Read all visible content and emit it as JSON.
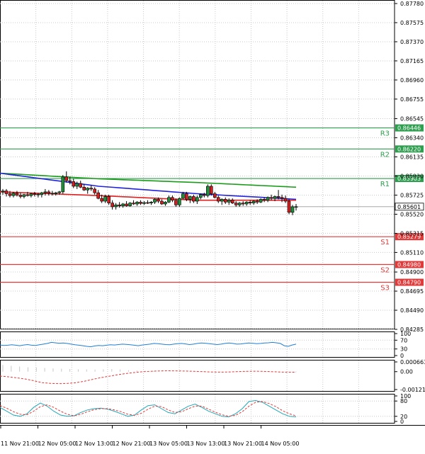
{
  "chart_data": {
    "type": "candlestick",
    "timeframe_labels": [
      "11 Nov 21:00",
      "12 Nov 05:00",
      "12 Nov 13:00",
      "12 Nov 21:00",
      "13 Nov 05:00",
      "13 Nov 13:00",
      "13 Nov 21:00",
      "14 Nov 05:00"
    ],
    "y_ticks": [
      "0.87780",
      "0.87575",
      "0.87370",
      "0.87165",
      "0.86960",
      "0.86755",
      "0.86545",
      "0.86340",
      "0.86135",
      "0.85930",
      "0.85725",
      "0.85520",
      "0.85315",
      "0.85110",
      "0.84900",
      "0.84695",
      "0.84490",
      "0.84285"
    ],
    "ylim": [
      0.84285,
      0.8778
    ],
    "last_price": {
      "label": "0.85601",
      "value": 0.85601
    },
    "levels": [
      {
        "name": "R3",
        "label": "0.86446",
        "value": 0.86446,
        "color": "#2e9e4f"
      },
      {
        "name": "R2",
        "label": "0.86220",
        "value": 0.8622,
        "color": "#2e9e4f"
      },
      {
        "name": "R1",
        "label": "0.85903",
        "value": 0.85903,
        "color": "#2e9e4f"
      },
      {
        "name": "S1",
        "label": "0.85279",
        "value": 0.85279,
        "color": "#e03b3b"
      },
      {
        "name": "S2",
        "label": "0.84980",
        "value": 0.8498,
        "color": "#e03b3b"
      },
      {
        "name": "S3",
        "label": "0.84790",
        "value": 0.8479,
        "color": "#e03b3b"
      }
    ],
    "ohlc": [
      [
        0.8576,
        0.8579,
        0.8573,
        0.8577
      ],
      [
        0.8577,
        0.8579,
        0.8571,
        0.8574
      ],
      [
        0.8574,
        0.8577,
        0.857,
        0.8572
      ],
      [
        0.8572,
        0.8576,
        0.857,
        0.85745
      ],
      [
        0.85745,
        0.8577,
        0.8571,
        0.85725
      ],
      [
        0.85725,
        0.8575,
        0.8569,
        0.8571
      ],
      [
        0.8571,
        0.8574,
        0.8569,
        0.8573
      ],
      [
        0.8573,
        0.8576,
        0.8571,
        0.8572
      ],
      [
        0.8572,
        0.8575,
        0.857,
        0.8574
      ],
      [
        0.8574,
        0.8576,
        0.8571,
        0.8573
      ],
      [
        0.8573,
        0.8575,
        0.857,
        0.85735
      ],
      [
        0.8573,
        0.8576,
        0.857,
        0.8575
      ],
      [
        0.8575,
        0.8579,
        0.8572,
        0.8576
      ],
      [
        0.8576,
        0.8578,
        0.8572,
        0.85745
      ],
      [
        0.85745,
        0.8577,
        0.8572,
        0.8574
      ],
      [
        0.8574,
        0.8576,
        0.8572,
        0.8575
      ],
      [
        0.8575,
        0.8577,
        0.8573,
        0.8576
      ],
      [
        0.8576,
        0.8594,
        0.8574,
        0.8592
      ],
      [
        0.8592,
        0.8598,
        0.8586,
        0.8588
      ],
      [
        0.8588,
        0.8592,
        0.8584,
        0.8587
      ],
      [
        0.8587,
        0.859,
        0.858,
        0.8582
      ],
      [
        0.8582,
        0.8587,
        0.8579,
        0.8585
      ],
      [
        0.8585,
        0.8588,
        0.858,
        0.8581
      ],
      [
        0.8581,
        0.8584,
        0.8577,
        0.8578
      ],
      [
        0.8578,
        0.8581,
        0.8574,
        0.858
      ],
      [
        0.858,
        0.8583,
        0.8577,
        0.8579
      ],
      [
        0.8579,
        0.8581,
        0.8573,
        0.8575
      ],
      [
        0.8575,
        0.8578,
        0.8568,
        0.8569
      ],
      [
        0.8569,
        0.8573,
        0.8564,
        0.8566
      ],
      [
        0.8566,
        0.8573,
        0.8564,
        0.8571
      ],
      [
        0.8571,
        0.8573,
        0.8562,
        0.8564
      ],
      [
        0.8564,
        0.8567,
        0.8557,
        0.856
      ],
      [
        0.856,
        0.8564,
        0.8557,
        0.8562
      ],
      [
        0.8562,
        0.8565,
        0.8559,
        0.8561
      ],
      [
        0.8561,
        0.8564,
        0.8559,
        0.8563
      ],
      [
        0.8563,
        0.8566,
        0.856,
        0.8561
      ],
      [
        0.8561,
        0.8565,
        0.856,
        0.8564
      ],
      [
        0.8564,
        0.8567,
        0.8562,
        0.8563
      ],
      [
        0.8563,
        0.8566,
        0.8561,
        0.8565
      ],
      [
        0.8565,
        0.8567,
        0.8562,
        0.85635
      ],
      [
        0.85635,
        0.8566,
        0.8562,
        0.85645
      ],
      [
        0.85645,
        0.8567,
        0.8563,
        0.8564
      ],
      [
        0.8564,
        0.8566,
        0.8562,
        0.8565
      ],
      [
        0.8565,
        0.8569,
        0.8563,
        0.8568
      ],
      [
        0.8568,
        0.857,
        0.8564,
        0.8566
      ],
      [
        0.8566,
        0.8568,
        0.8562,
        0.8563
      ],
      [
        0.8563,
        0.8566,
        0.8561,
        0.8565
      ],
      [
        0.8565,
        0.8572,
        0.8564,
        0.857
      ],
      [
        0.857,
        0.8572,
        0.8565,
        0.8567
      ],
      [
        0.8567,
        0.8569,
        0.856,
        0.8562
      ],
      [
        0.8562,
        0.857,
        0.856,
        0.8569
      ],
      [
        0.8569,
        0.8576,
        0.8568,
        0.8574
      ],
      [
        0.8574,
        0.8576,
        0.8566,
        0.8568
      ],
      [
        0.8568,
        0.8572,
        0.8564,
        0.8571
      ],
      [
        0.8571,
        0.8573,
        0.8564,
        0.8566
      ],
      [
        0.8566,
        0.8572,
        0.8563,
        0.857
      ],
      [
        0.857,
        0.8574,
        0.8568,
        0.8573
      ],
      [
        0.8573,
        0.8575,
        0.857,
        0.8572
      ],
      [
        0.8572,
        0.8584,
        0.857,
        0.8582
      ],
      [
        0.8582,
        0.8584,
        0.8572,
        0.8574
      ],
      [
        0.8574,
        0.8576,
        0.8569,
        0.857
      ],
      [
        0.857,
        0.8572,
        0.8564,
        0.8566
      ],
      [
        0.8566,
        0.8569,
        0.8562,
        0.8568
      ],
      [
        0.8568,
        0.857,
        0.8563,
        0.8565
      ],
      [
        0.8565,
        0.8569,
        0.8562,
        0.8567
      ],
      [
        0.8567,
        0.8569,
        0.8563,
        0.8564
      ],
      [
        0.8564,
        0.8566,
        0.856,
        0.8562
      ],
      [
        0.8562,
        0.8565,
        0.856,
        0.8564
      ],
      [
        0.8564,
        0.8566,
        0.8561,
        0.8563
      ],
      [
        0.8563,
        0.8566,
        0.8561,
        0.8565
      ],
      [
        0.8565,
        0.8567,
        0.8562,
        0.8564
      ],
      [
        0.8564,
        0.8567,
        0.8562,
        0.8566
      ],
      [
        0.8566,
        0.8568,
        0.8563,
        0.8565
      ],
      [
        0.8565,
        0.8569,
        0.8564,
        0.8568
      ],
      [
        0.8568,
        0.857,
        0.8565,
        0.8567
      ],
      [
        0.8567,
        0.8571,
        0.8565,
        0.857
      ],
      [
        0.857,
        0.8573,
        0.8567,
        0.8569
      ],
      [
        0.8569,
        0.8572,
        0.8566,
        0.8571
      ],
      [
        0.8571,
        0.8578,
        0.8568,
        0.857
      ],
      [
        0.857,
        0.8573,
        0.8565,
        0.8569
      ],
      [
        0.8569,
        0.8572,
        0.8564,
        0.8566
      ],
      [
        0.8566,
        0.8568,
        0.8552,
        0.8554
      ],
      [
        0.8554,
        0.8562,
        0.8551,
        0.856
      ],
      [
        0.856,
        0.8563,
        0.8556,
        0.85601
      ]
    ],
    "overlays": [
      {
        "type": "line",
        "color": "#1a9c1a",
        "values": [
          0.8596,
          0.859,
          0.8586,
          0.8581
        ]
      },
      {
        "type": "line",
        "color": "#2222dd",
        "values": [
          0.8596,
          0.8582,
          0.8574,
          0.8568
        ]
      },
      {
        "type": "line",
        "color": "#dd2222",
        "values": [
          0.8576,
          0.8572,
          0.8567,
          0.8567
        ]
      }
    ],
    "indicator_rsi": {
      "ticks": [
        "100",
        "70",
        "30",
        "0"
      ],
      "ylim": [
        0,
        100
      ],
      "color": "#1e7fd6",
      "values": [
        48,
        46,
        47,
        49,
        47,
        45,
        48,
        50,
        47,
        46,
        49,
        52,
        55,
        60,
        58,
        56,
        57,
        55,
        52,
        49,
        47,
        45,
        42,
        40,
        44,
        46,
        45,
        47,
        49,
        48,
        50,
        52,
        51,
        49,
        47,
        45,
        48,
        50,
        52,
        55,
        54,
        52,
        50,
        49,
        52,
        54,
        55,
        53,
        50,
        52,
        55,
        57,
        56,
        54,
        52,
        50,
        52,
        55,
        57,
        55,
        52,
        53,
        55,
        57,
        56,
        54,
        55,
        57,
        58,
        60,
        58,
        55,
        45,
        42,
        48,
        52
      ]
    },
    "indicator_macd": {
      "ticks": [
        "0.000663",
        "0.00",
        "-0.001218"
      ],
      "ylim": [
        -0.001218,
        0.000663
      ],
      "histogram_color": "#c8c8c8",
      "signal_color": "#e03b3b",
      "histogram": [
        0.00045,
        0.0004,
        0.00035,
        0.0003,
        0.00028,
        0.00025,
        0.00022,
        0.0002,
        0.00018,
        0.00016,
        0.00015,
        0.00014,
        0.00016,
        0.00018,
        0.00015,
        0.0001,
        8e-05,
        6e-05,
        5e-05,
        3e-05,
        2e-05,
        1e-05,
        1e-05,
        2e-05,
        3e-05,
        2e-05,
        1e-05,
        2e-05,
        3e-05,
        4e-05,
        3e-05,
        2e-05,
        1e-05,
        2e-05,
        3e-05,
        2e-05
      ],
      "signal": [
        -0.0003,
        -0.00035,
        -0.00042,
        -0.0005,
        -0.00062,
        -0.00075,
        -0.0008,
        -0.00082,
        -0.0008,
        -0.00075,
        -0.00065,
        -0.00052,
        -0.0004,
        -0.0003,
        -0.0002,
        -0.00012,
        -5e-05,
        0.0,
        3e-05,
        5e-05,
        6e-05,
        5e-05,
        4e-05,
        2e-05,
        0.0,
        -2e-05,
        -3e-05,
        -2e-05,
        0.0,
        2e-05,
        3e-05,
        2e-05,
        0.0,
        -2e-05,
        -4e-05,
        -3e-05
      ]
    },
    "indicator_stoch": {
      "ticks": [
        "100",
        "80",
        "20",
        "0"
      ],
      "ylim": [
        0,
        100
      ],
      "main_color": "#21a8b8",
      "signal_color": "#e03b3b",
      "main": [
        55,
        40,
        25,
        20,
        30,
        55,
        72,
        60,
        40,
        25,
        20,
        22,
        35,
        45,
        50,
        52,
        48,
        40,
        30,
        20,
        25,
        45,
        62,
        65,
        50,
        35,
        30,
        45,
        60,
        68,
        55,
        40,
        30,
        20,
        18,
        30,
        50,
        78,
        82,
        75,
        60,
        45,
        30,
        20,
        18
      ],
      "signal": [
        62,
        52,
        38,
        28,
        26,
        40,
        58,
        65,
        55,
        40,
        28,
        22,
        28,
        38,
        46,
        50,
        50,
        45,
        38,
        28,
        24,
        32,
        48,
        60,
        58,
        45,
        35,
        38,
        50,
        60,
        60,
        48,
        36,
        26,
        20,
        24,
        38,
        60,
        75,
        78,
        70,
        58,
        42,
        30,
        22
      ]
    }
  }
}
